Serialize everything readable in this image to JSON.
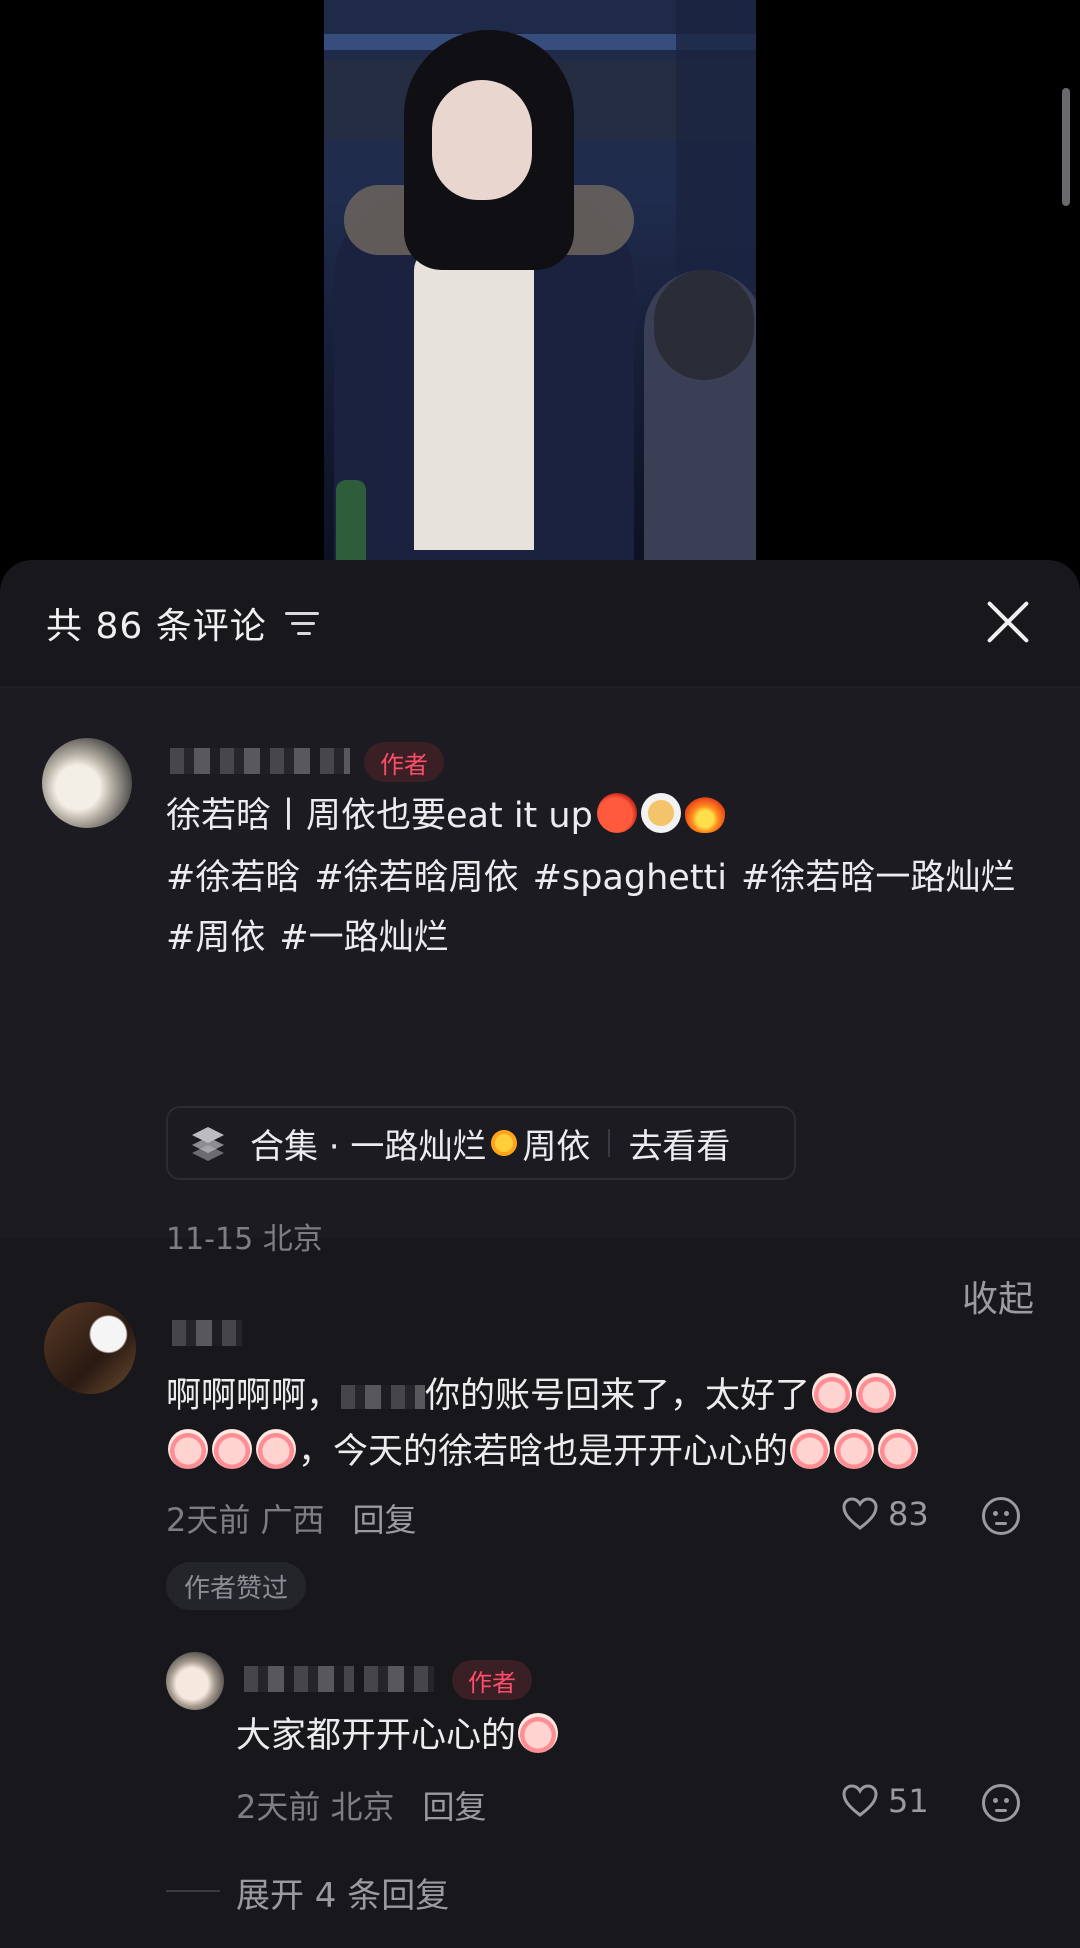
{
  "comments_panel": {
    "count_title": "共 86 条评论",
    "sort_icon": "sort-lines-icon",
    "close_icon": "close-icon"
  },
  "author_post": {
    "author_badge": "作者",
    "title_text": "徐若晗丨周依也要eat it up",
    "title_emojis": [
      "tomato",
      "spaghetti",
      "fire"
    ],
    "tags": [
      "#徐若晗",
      "#徐若晗周依",
      "#spaghetti",
      "#徐若晗一路灿烂",
      "#周依",
      "#一路灿烂"
    ],
    "collection": {
      "prefix": "合集 · 一路灿烂",
      "suffix": "周依",
      "action": "去看看"
    },
    "meta": "11-15 北京",
    "collapse_label": "收起"
  },
  "comments": [
    {
      "text_before": "啊啊啊啊，",
      "text_after": "你的账号回来了，太好了",
      "text_line2": "，今天的徐若晗也是开开心心的",
      "meta": "2天前 广西",
      "reply_label": "回复",
      "likes": "83",
      "liked_by_author": "作者赞过",
      "replies": [
        {
          "author_badge": "作者",
          "text": "大家都开开心心的",
          "meta": "2天前 北京",
          "reply_label": "回复",
          "likes": "51"
        }
      ],
      "expand_label": "展开 4 条回复"
    }
  ],
  "colors": {
    "panel_bg": "#17171c",
    "author_badge_text": "#ff4d6a",
    "muted_text": "#7d7d84"
  }
}
